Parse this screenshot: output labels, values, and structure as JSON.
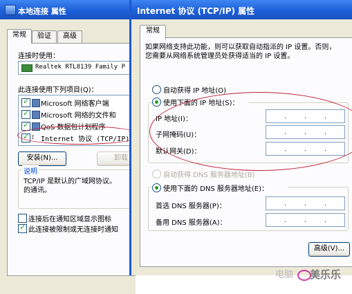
{
  "local_dialog": {
    "title": "本地连接 属性",
    "tabs": [
      "常规",
      "验证",
      "高级"
    ],
    "connect_using_label": "连接时使用：",
    "adapter_name": "Realtek RTL8139 Family P",
    "items_label": "此连接使用下列项目(Q)：",
    "items": [
      {
        "label": "Microsoft 网络客户端",
        "checked": true
      },
      {
        "label": "Microsoft 网络的文件和",
        "checked": true
      },
      {
        "label": "QoS 数据包计划程序",
        "checked": true
      },
      {
        "label": "Internet 协议 (TCP/IP)",
        "checked": true
      }
    ],
    "install_button": "安装(N)...",
    "uninstall_button": "卸载",
    "description_group": "说明",
    "description_line1": "TCP/IP 是默认的广域网协议。",
    "description_line2": "的通讯。",
    "show_icon_label": "连接后在通知区域显示图标",
    "notify_label": "此连接被限制或无连接时通知",
    "show_icon_checked": false,
    "notify_checked": true
  },
  "tcpip_dialog": {
    "title": "Internet 协议 (TCP/IP) 属性",
    "tab": "常规",
    "intro_line1": "如果网络支持此功能，则可以获取自动指派的 IP 设置。否则，",
    "intro_line2": "您需要从网络系统管理员处获得适当的 IP 设置。",
    "auto_ip_label": "自动获得 IP 地址(O)",
    "manual_ip_label": "使用下面的 IP 地址(S)：",
    "ip_label": "IP 地址(I)：",
    "subnet_label": "子网掩码(U)：",
    "gateway_label": "默认网关(D)：",
    "auto_dns_label": "自动获得 DNS 服务器地址(B)",
    "manual_dns_label": "使用下面的 DNS 服务器地址(E)：",
    "preferred_dns_label": "首选 DNS 服务器(P)：",
    "alternate_dns_label": "备用 DNS 服务器(A)：",
    "advanced_button": "高级(V)...",
    "selected_ip_mode": "manual",
    "selected_dns_mode": "manual",
    "ip_dot": "."
  },
  "watermark": {
    "text": "美乐乐",
    "faint": "电脑"
  },
  "colors": {
    "titlebar": "#1d5fd8",
    "dialog_bg": "#ece9d8",
    "annotation": "#c3223b",
    "check": "#21a121"
  }
}
